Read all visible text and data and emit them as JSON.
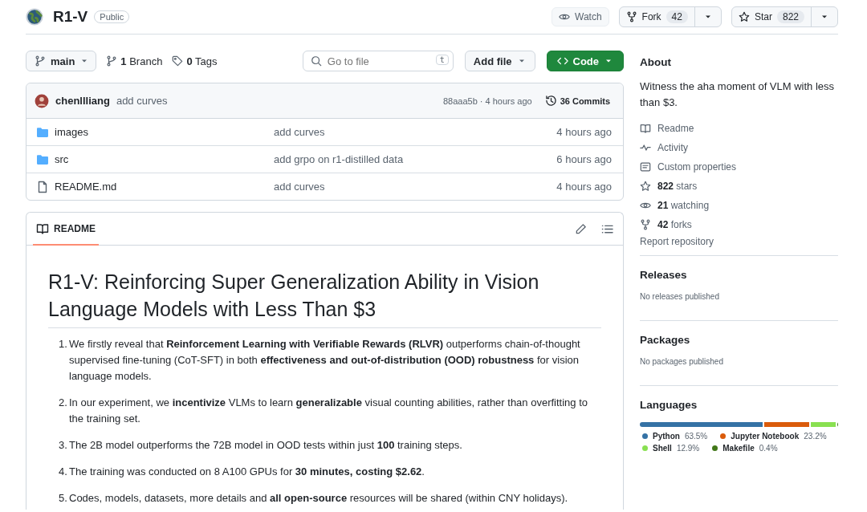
{
  "repo": {
    "name": "R1-V",
    "visibility": "Public"
  },
  "header_actions": [
    {
      "kind": "watch",
      "label": "Watch"
    },
    {
      "kind": "fork",
      "label": "Fork",
      "count": "42"
    },
    {
      "kind": "star",
      "label": "Star",
      "count": "822"
    }
  ],
  "toolbar": {
    "branch": "main",
    "branches": {
      "count": "1",
      "label": "Branch"
    },
    "tags": {
      "count": "0",
      "label": "Tags"
    },
    "search": {
      "placeholder": "Go to file",
      "shortcut": "t"
    },
    "add_file": "Add file",
    "code": "Code"
  },
  "latest_commit": {
    "author": "chenllliang",
    "message": "add curves",
    "hash_time": "88aaa5b · 4 hours ago",
    "commits": "36 Commits"
  },
  "files": [
    {
      "kind": "folder",
      "name": "images",
      "message": "add curves",
      "time": "4 hours ago"
    },
    {
      "kind": "folder",
      "name": "src",
      "message": "add grpo on r1-distilled data",
      "time": "6 hours ago"
    },
    {
      "kind": "file",
      "name": "README.md",
      "message": "add curves",
      "time": "4 hours ago"
    }
  ],
  "readme": {
    "tab": "README",
    "title": "R1-V: Reinforcing Super Generalization Ability in Vision Language Models with Less Than $3",
    "items": [
      {
        "number": "1.",
        "text": "We firstly reveal that **Reinforcement Learning with Verifiable Rewards (RLVR)** outperforms chain-of-thought supervised fine-tuning (CoT-SFT) in both **effectiveness and out-of-distribution (OOD) robustness** for vision language models."
      },
      {
        "number": "2.",
        "text": "In our experiment, we **incentivize** VLMs to learn **generalizable** visual counting abilities, rather than overfitting to the training set."
      },
      {
        "number": "3.",
        "text": "The 2B model outperforms the 72B model in OOD tests within just **100** training steps."
      },
      {
        "number": "4.",
        "text": "The training was conducted on 8 A100 GPUs for **30 minutes, costing $2.62**."
      },
      {
        "number": "5.",
        "text": "Codes, models, datasets, more details and **all open-source** resources will be shared (within CNY holidays)."
      }
    ]
  },
  "about": {
    "title": "About",
    "description": "Witness the aha moment of VLM with less than $3.",
    "links": [
      {
        "kind": "book",
        "text": "Readme"
      },
      {
        "kind": "pulse",
        "text": "Activity"
      },
      {
        "kind": "note",
        "text": "Custom properties"
      },
      {
        "kind": "star",
        "text": "**822** stars"
      },
      {
        "kind": "eye",
        "text": "**21** watching"
      },
      {
        "kind": "fork",
        "text": "**42** forks"
      }
    ],
    "report": "Report repository"
  },
  "releases": {
    "title": "Releases",
    "note": "No releases published"
  },
  "packages": {
    "title": "Packages",
    "note": "No packages published"
  },
  "languages": {
    "title": "Languages",
    "items": [
      {
        "name": "Python",
        "percent": "63.5%",
        "color": "#3572a5"
      },
      {
        "name": "Jupyter Notebook",
        "percent": "23.2%",
        "color": "#da5b0b"
      },
      {
        "name": "Shell",
        "percent": "12.9%",
        "color": "#89e051"
      },
      {
        "name": "Makefile",
        "percent": "0.4%",
        "color": "#427819"
      }
    ]
  }
}
